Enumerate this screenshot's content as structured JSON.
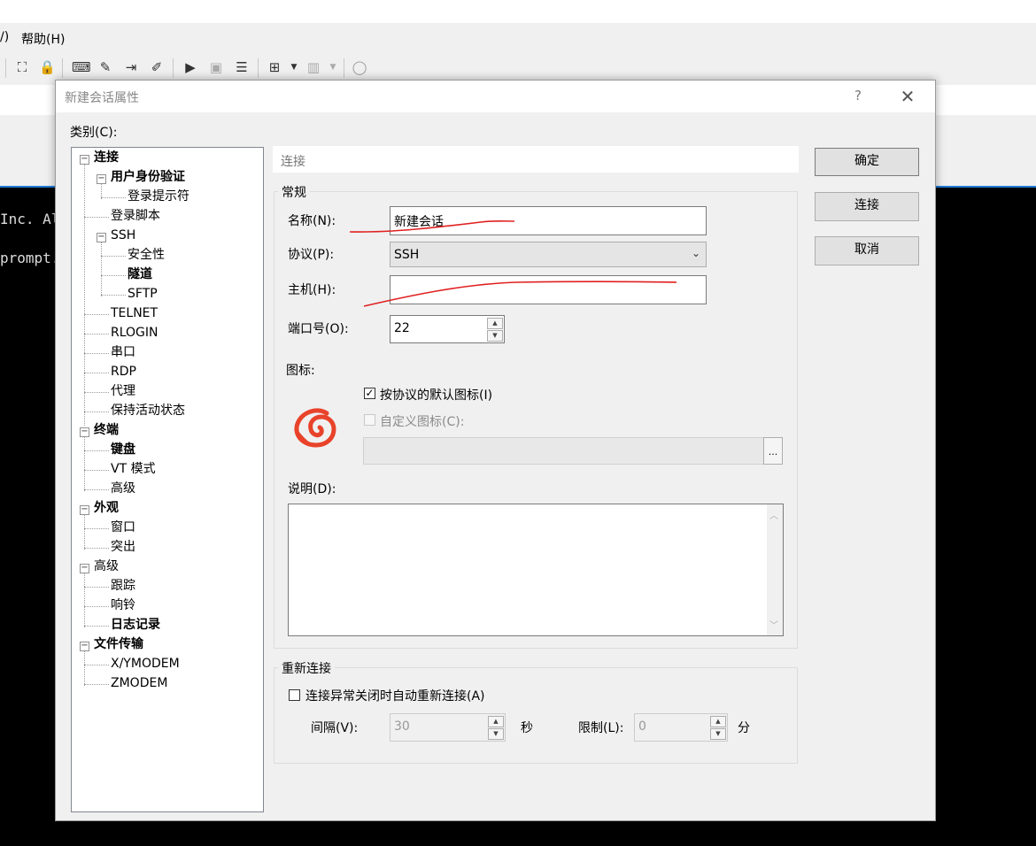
{
  "app": {
    "menu": {
      "view_fragment": "/)",
      "help": "帮助(H)"
    },
    "terminal_lines": [
      "Inc. Al",
      "prompt."
    ]
  },
  "dialog": {
    "title": "新建会话属性",
    "help_glyph": "?",
    "close_glyph": "✕",
    "category_label": "类别(C):",
    "tree": [
      {
        "label": "连接",
        "bold": true
      },
      {
        "label": "用户身份验证",
        "bold": true
      },
      {
        "label": "登录提示符",
        "bold": false
      },
      {
        "label": "登录脚本",
        "bold": false
      },
      {
        "label": "SSH",
        "bold": false
      },
      {
        "label": "安全性",
        "bold": false
      },
      {
        "label": "隧道",
        "bold": true
      },
      {
        "label": "SFTP",
        "bold": false
      },
      {
        "label": "TELNET",
        "bold": false
      },
      {
        "label": "RLOGIN",
        "bold": false
      },
      {
        "label": "串口",
        "bold": false
      },
      {
        "label": "RDP",
        "bold": false
      },
      {
        "label": "代理",
        "bold": false
      },
      {
        "label": "保持活动状态",
        "bold": false
      },
      {
        "label": "终端",
        "bold": true
      },
      {
        "label": "键盘",
        "bold": true
      },
      {
        "label": "VT 模式",
        "bold": false
      },
      {
        "label": "高级",
        "bold": false
      },
      {
        "label": "外观",
        "bold": true
      },
      {
        "label": "窗口",
        "bold": false
      },
      {
        "label": "突出",
        "bold": false
      },
      {
        "label": "高级",
        "bold": false
      },
      {
        "label": "跟踪",
        "bold": false
      },
      {
        "label": "响铃",
        "bold": false
      },
      {
        "label": "日志记录",
        "bold": true
      },
      {
        "label": "文件传输",
        "bold": true
      },
      {
        "label": "X/YMODEM",
        "bold": false
      },
      {
        "label": "ZMODEM",
        "bold": false
      }
    ],
    "section_header": "连接",
    "general": {
      "group_title": "常规",
      "name_label": "名称(N):",
      "name_value": "新建会话",
      "protocol_label": "协议(P):",
      "protocol_value": "SSH",
      "host_label": "主机(H):",
      "host_value": "",
      "port_label": "端口号(O):",
      "port_value": "22",
      "icon_label": "图标:",
      "default_icon_label": "按协议的默认图标(I)",
      "default_icon_checked": true,
      "custom_icon_label": "自定义图标(C):",
      "custom_icon_checked": false,
      "browse_label": "...",
      "description_label": "说明(D):",
      "description_value": ""
    },
    "reconnect": {
      "group_title": "重新连接",
      "auto_reconnect_label": "连接异常关闭时自动重新连接(A)",
      "auto_reconnect_checked": false,
      "interval_label": "间隔(V):",
      "interval_value": "30",
      "interval_unit": "秒",
      "limit_label": "限制(L):",
      "limit_value": "0",
      "limit_unit": "分"
    },
    "buttons": {
      "ok": "确定",
      "connect": "连接",
      "cancel": "取消"
    },
    "colors": {
      "annotation_red": "#e02020",
      "icon_red": "#e8432a",
      "accent_blue": "#1f7ad6"
    }
  }
}
